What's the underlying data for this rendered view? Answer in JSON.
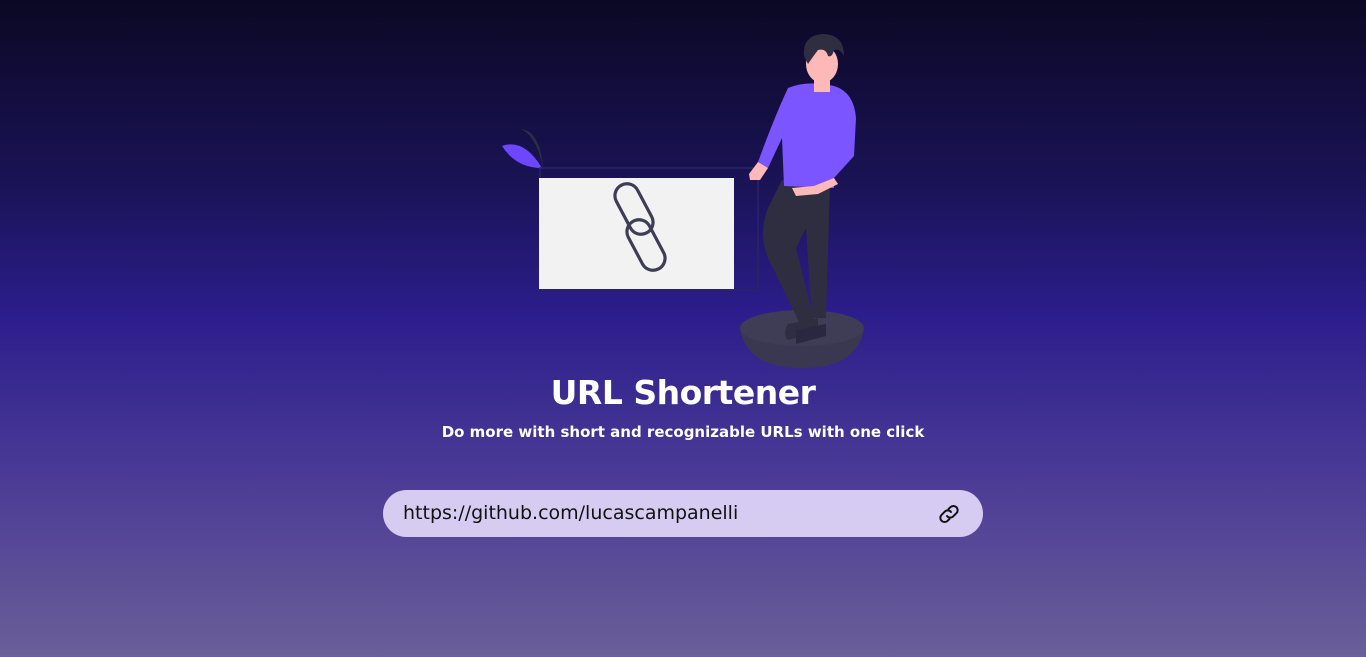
{
  "hero": {
    "title": "URL Shortener",
    "subtitle": "Do more with short and recognizable URLs with one click",
    "illustration": "person-with-link-chain-card"
  },
  "form": {
    "url_value": "https://github.com/lucascampanelli",
    "submit_icon": "link-icon"
  },
  "colors": {
    "background_top": "#0b0824",
    "background_mid": "#2c1d8c",
    "background_bottom": "#6a5f98",
    "accent": "#6c47ff",
    "input_background": "#d6ccf2",
    "text": "#ffffff"
  }
}
